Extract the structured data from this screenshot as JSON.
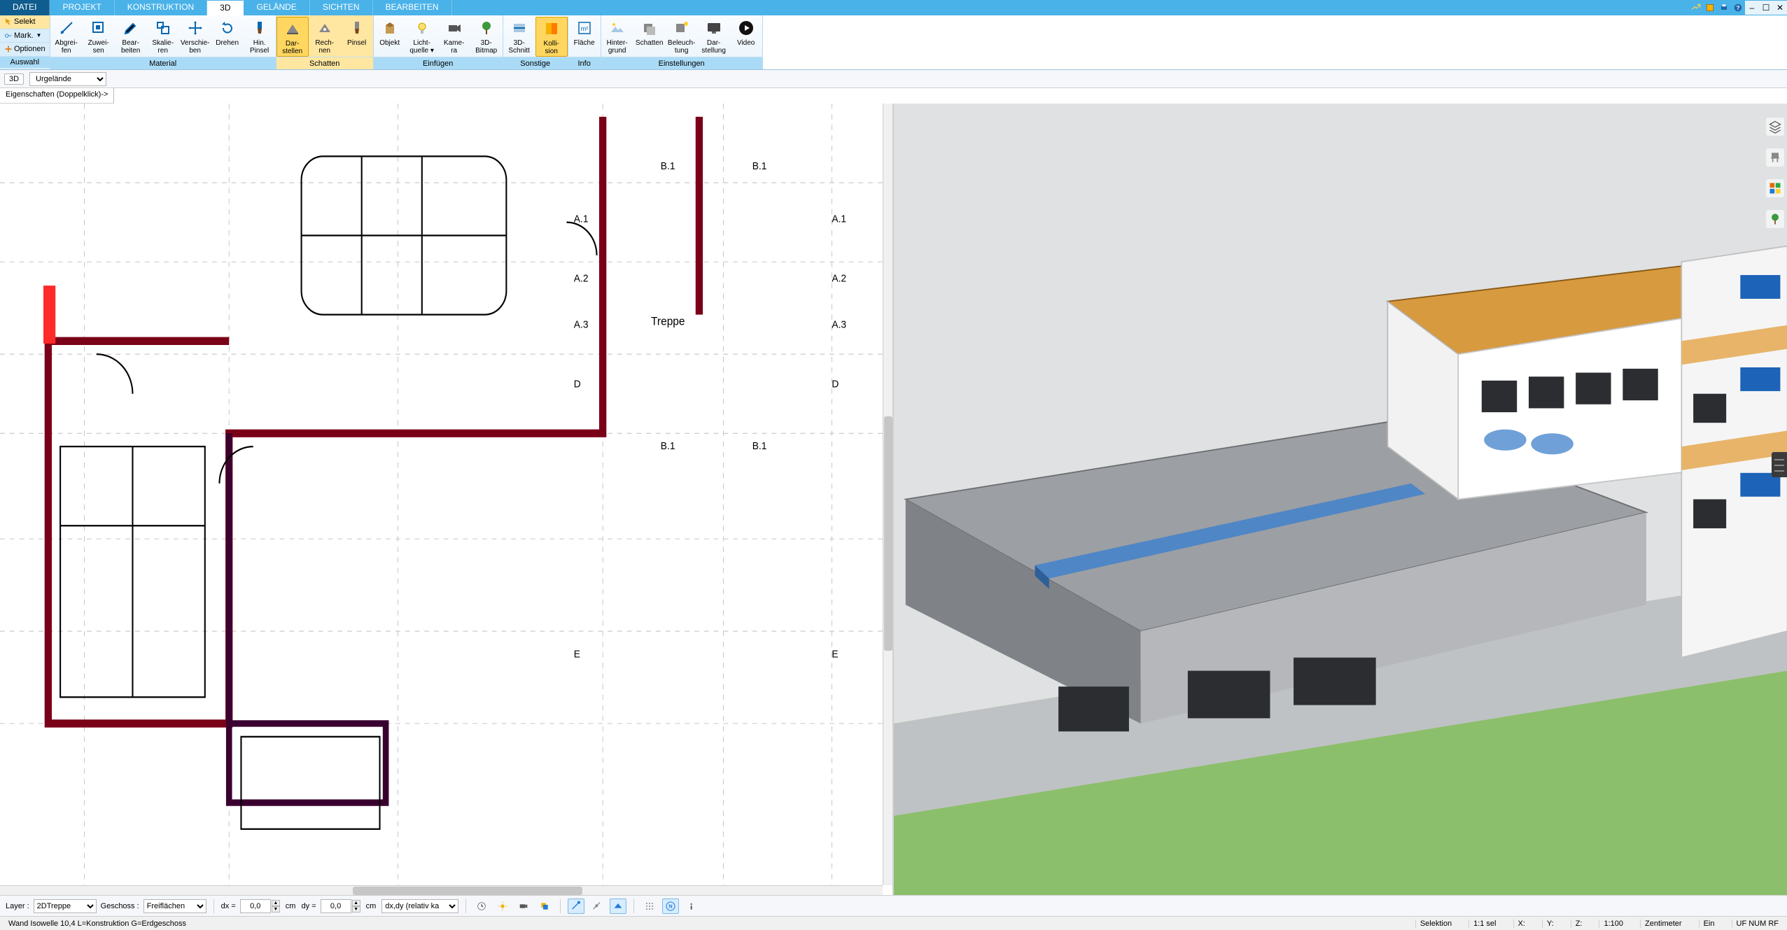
{
  "menu": {
    "tabs": [
      "DATEI",
      "PROJEKT",
      "KONSTRUKTION",
      "3D",
      "GELÄNDE",
      "SICHTEN",
      "BEARBEITEN"
    ],
    "active_index": 3,
    "dark_index": 0
  },
  "sidecol": {
    "rows": [
      "Selekt",
      "Mark.",
      "Optionen"
    ],
    "footer": "Auswahl"
  },
  "ribbon_groups": [
    {
      "id": "material",
      "footer": "Material",
      "active": false,
      "buttons": [
        {
          "id": "abgreifen",
          "l1": "Abgrei-",
          "l2": "fen"
        },
        {
          "id": "zuweisen",
          "l1": "Zuwei-",
          "l2": "sen"
        },
        {
          "id": "bearbeiten",
          "l1": "Bear-",
          "l2": "beiten"
        },
        {
          "id": "skalieren",
          "l1": "Skalie-",
          "l2": "ren"
        },
        {
          "id": "verschieben",
          "l1": "Verschie-",
          "l2": "ben"
        },
        {
          "id": "drehen",
          "l1": "Drehen",
          "l2": ""
        },
        {
          "id": "hinpinsel",
          "l1": "Hin.",
          "l2": "Pinsel"
        }
      ]
    },
    {
      "id": "schatten",
      "footer": "Schatten",
      "active": true,
      "buttons": [
        {
          "id": "darstellen",
          "l1": "Dar-",
          "l2": "stellen",
          "active": true
        },
        {
          "id": "rechnen",
          "l1": "Rech-",
          "l2": "nen"
        },
        {
          "id": "pinsel",
          "l1": "Pinsel",
          "l2": ""
        }
      ]
    },
    {
      "id": "einfuegen",
      "footer": "Einfügen",
      "active": false,
      "buttons": [
        {
          "id": "objekt",
          "l1": "Objekt",
          "l2": ""
        },
        {
          "id": "lichtquelle",
          "l1": "Licht-",
          "l2": "quelle ▾"
        },
        {
          "id": "kamera",
          "l1": "Kame-",
          "l2": "ra"
        },
        {
          "id": "3dbitmap",
          "l1": "3D-",
          "l2": "Bitmap"
        }
      ]
    },
    {
      "id": "sonstige",
      "footer": "Sonstige",
      "active": false,
      "buttons": [
        {
          "id": "3dschnitt",
          "l1": "3D-",
          "l2": "Schnitt"
        },
        {
          "id": "kollision",
          "l1": "Kolli-",
          "l2": "sion",
          "active": true
        }
      ]
    },
    {
      "id": "info",
      "footer": "Info",
      "active": false,
      "buttons": [
        {
          "id": "flaeche",
          "l1": "Fläche",
          "l2": ""
        }
      ]
    },
    {
      "id": "einstellungen",
      "footer": "Einstellungen",
      "active": false,
      "buttons": [
        {
          "id": "hintergrund",
          "l1": "Hinter-",
          "l2": "grund"
        },
        {
          "id": "schattene",
          "l1": "Schatten",
          "l2": ""
        },
        {
          "id": "beleuchtung",
          "l1": "Beleuch-",
          "l2": "tung"
        },
        {
          "id": "darstellung",
          "l1": "Dar-",
          "l2": "stellung"
        },
        {
          "id": "video",
          "l1": "Video",
          "l2": ""
        }
      ]
    }
  ],
  "subbar": {
    "tag": "3D",
    "combo": "Urgelände"
  },
  "props_hint": "Eigenschaften (Doppelklick)->",
  "plan_labels": {
    "treppe": "Treppe"
  },
  "bottom": {
    "layer_label": "Layer :",
    "layer_value": "2DTreppe",
    "geschoss_label": "Geschoss :",
    "geschoss_value": "Freiflächen",
    "dxlabel": "dx =",
    "dx": "0,0",
    "dxu": "cm",
    "dylabel": "dy =",
    "dy": "0,0",
    "dyu": "cm",
    "mode": "dx,dy (relativ ka"
  },
  "status": {
    "left": "Wand Isowelle 10,4 L=Konstruktion G=Erdgeschoss",
    "sel": "Selektion",
    "ratio": "1:1 sel",
    "x": "X:",
    "y": "Y:",
    "z": "Z:",
    "scale": "1:100",
    "unit": "Zentimeter",
    "onoff": "Ein",
    "caps": "UF  NUM  RF"
  }
}
